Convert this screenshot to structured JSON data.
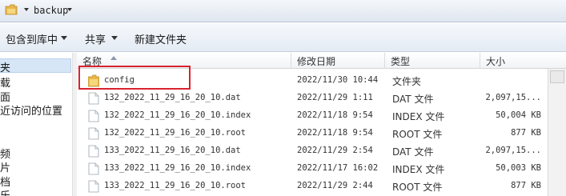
{
  "address": {
    "path": "backup"
  },
  "toolbar": {
    "include_library": "包含到库中",
    "share": "共享",
    "new_folder": "新建文件夹"
  },
  "nav": {
    "items": [
      "夹",
      "载",
      "面",
      "近访问的位置",
      "",
      "",
      "频",
      "片",
      "档",
      "乐"
    ]
  },
  "columns": {
    "name": "名称",
    "modified": "修改日期",
    "type": "类型",
    "size": "大小"
  },
  "files": [
    {
      "name": "config",
      "modified": "2022/11/30 10:44",
      "type": "文件夹",
      "size": "",
      "icon": "folder-icon"
    },
    {
      "name": "132_2022_11_29_16_20_10.dat",
      "modified": "2022/11/29 1:11",
      "type": "DAT 文件",
      "size": "2,097,15...",
      "icon": "file-icon"
    },
    {
      "name": "132_2022_11_29_16_20_10.index",
      "modified": "2022/11/18 9:54",
      "type": "INDEX 文件",
      "size": "50,004 KB",
      "icon": "file-icon"
    },
    {
      "name": "132_2022_11_29_16_20_10.root",
      "modified": "2022/11/18 9:54",
      "type": "ROOT 文件",
      "size": "877 KB",
      "icon": "file-icon"
    },
    {
      "name": "133_2022_11_29_16_20_10.dat",
      "modified": "2022/11/29 2:54",
      "type": "DAT 文件",
      "size": "2,097,15...",
      "icon": "file-icon"
    },
    {
      "name": "133_2022_11_29_16_20_10.index",
      "modified": "2022/11/17 16:02",
      "type": "INDEX 文件",
      "size": "50,003 KB",
      "icon": "file-icon"
    },
    {
      "name": "133_2022_11_29_16_20_10.root",
      "modified": "2022/11/29 2:44",
      "type": "ROOT 文件",
      "size": "877 KB",
      "icon": "file-icon"
    }
  ],
  "colors": {
    "highlight_box": "#d9232e",
    "folder": "#e8b84a",
    "selection": "#d6e6f7"
  }
}
